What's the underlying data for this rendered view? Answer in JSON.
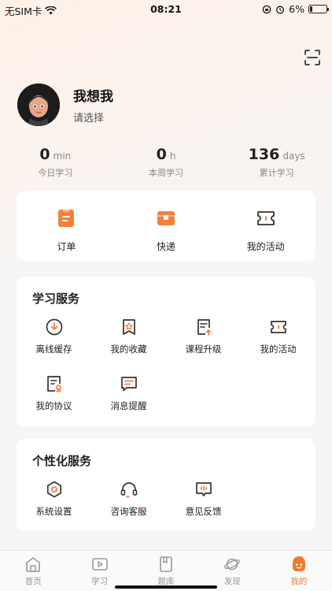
{
  "status_bar": {
    "carrier": "无SIM卡",
    "time": "08:21",
    "battery": "6%"
  },
  "header": {
    "scan_icon": "scan-icon"
  },
  "profile": {
    "name": "我想我",
    "subtitle": "请选择"
  },
  "stats": [
    {
      "value": "0",
      "unit": "min",
      "label": "今日学习"
    },
    {
      "value": "0",
      "unit": "h",
      "label": "本周学习"
    },
    {
      "value": "136",
      "unit": "days",
      "label": "累计学习"
    }
  ],
  "quick_actions": [
    {
      "label": "订单",
      "icon": "order-icon"
    },
    {
      "label": "快递",
      "icon": "delivery-icon"
    },
    {
      "label": "我的活动",
      "icon": "activity-ticket-icon"
    }
  ],
  "study_services": {
    "title": "学习服务",
    "items": [
      {
        "label": "离线缓存",
        "icon": "download-icon"
      },
      {
        "label": "我的收藏",
        "icon": "star-bookmark-icon"
      },
      {
        "label": "课程升级",
        "icon": "upgrade-document-icon"
      },
      {
        "label": "我的活动",
        "icon": "ticket-icon"
      },
      {
        "label": "我的协议",
        "icon": "agreement-icon"
      },
      {
        "label": "消息提醒",
        "icon": "message-icon"
      }
    ]
  },
  "personal_services": {
    "title": "个性化服务",
    "items": [
      {
        "label": "系统设置",
        "icon": "settings-icon"
      },
      {
        "label": "咨询客服",
        "icon": "headset-icon"
      },
      {
        "label": "意见反馈",
        "icon": "feedback-icon"
      }
    ]
  },
  "tabbar": [
    {
      "label": "首页",
      "icon": "home-icon",
      "active": false
    },
    {
      "label": "学习",
      "icon": "play-icon",
      "active": false
    },
    {
      "label": "题库",
      "icon": "book-icon",
      "active": false
    },
    {
      "label": "发现",
      "icon": "planet-icon",
      "active": false
    },
    {
      "label": "我的",
      "icon": "profile-face-icon",
      "active": true
    }
  ],
  "colors": {
    "accent": "#f27a2e",
    "icon_orange": "#f5803a",
    "text": "#222222"
  }
}
